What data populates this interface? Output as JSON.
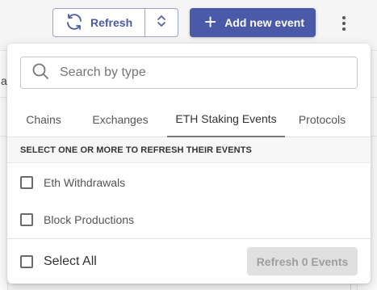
{
  "background": {
    "left_fragment": "a"
  },
  "toolbar": {
    "refresh_label": "Refresh",
    "add_event_label": "Add new event",
    "accent_color": "#4b5aa8"
  },
  "dropdown": {
    "search": {
      "placeholder": "Search by type",
      "value": ""
    },
    "tabs": [
      {
        "label": "Chains",
        "active": false
      },
      {
        "label": "Exchanges",
        "active": false
      },
      {
        "label": "ETH Staking Events",
        "active": true
      },
      {
        "label": "Protocols",
        "active": false
      }
    ],
    "section_header": "SELECT ONE OR MORE TO REFRESH THEIR EVENTS",
    "options": [
      {
        "label": "Eth Withdrawals",
        "checked": false
      },
      {
        "label": "Block Productions",
        "checked": false
      }
    ],
    "select_all_label": "Select All",
    "refresh_button_label": "Refresh 0 Events"
  }
}
